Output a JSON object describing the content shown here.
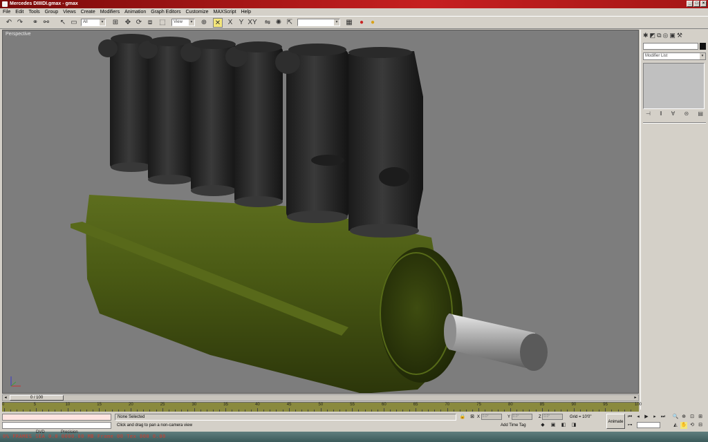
{
  "window": {
    "title": "Mercedes DIIIIDI.gmax - gmax",
    "min": "_",
    "max": "□",
    "close": "×"
  },
  "menu": [
    "File",
    "Edit",
    "Tools",
    "Group",
    "Views",
    "Create",
    "Modifiers",
    "Animation",
    "Graph Editors",
    "Customize",
    "MAXScript",
    "Help"
  ],
  "toolbar": {
    "selection_filter": "All",
    "ref_coord": "View",
    "named_selection": ""
  },
  "viewport": {
    "label": "Perspective"
  },
  "command_panel": {
    "modifier_list": "Modifier List"
  },
  "timeline": {
    "slider": "0 / 100",
    "ticks": [
      "0",
      "5",
      "10",
      "15",
      "20",
      "25",
      "30",
      "35",
      "40",
      "45",
      "50",
      "55",
      "60",
      "65",
      "70",
      "75",
      "80",
      "85",
      "90",
      "95",
      "100"
    ]
  },
  "status": {
    "selection": "None Selected",
    "prompt": "Click and drag to pan a non-camera view",
    "x_label": "X",
    "y_label": "Y",
    "z_label": "Z",
    "x_val": "0.0°",
    "y_val": "0.0°",
    "z_val": "0.0°",
    "grid": "Grid = 10'0\"",
    "add_time_tag": "Add Time Tag",
    "animate": "Animate"
  },
  "task_strip": {
    "label_left": "DVD",
    "label_mid": "Precision",
    "text": "0% FRAMES SEA 0.0 0000.00 MB Frame 00 Tex 000 0.00",
    "tray": ""
  },
  "colors": {
    "viewport_bg": "#7d7d7d",
    "crankcase": "#4a5a14",
    "cylinders": "#2a2a2a",
    "trackbar": "#8a8a3e",
    "titlebar": "#a51616"
  }
}
